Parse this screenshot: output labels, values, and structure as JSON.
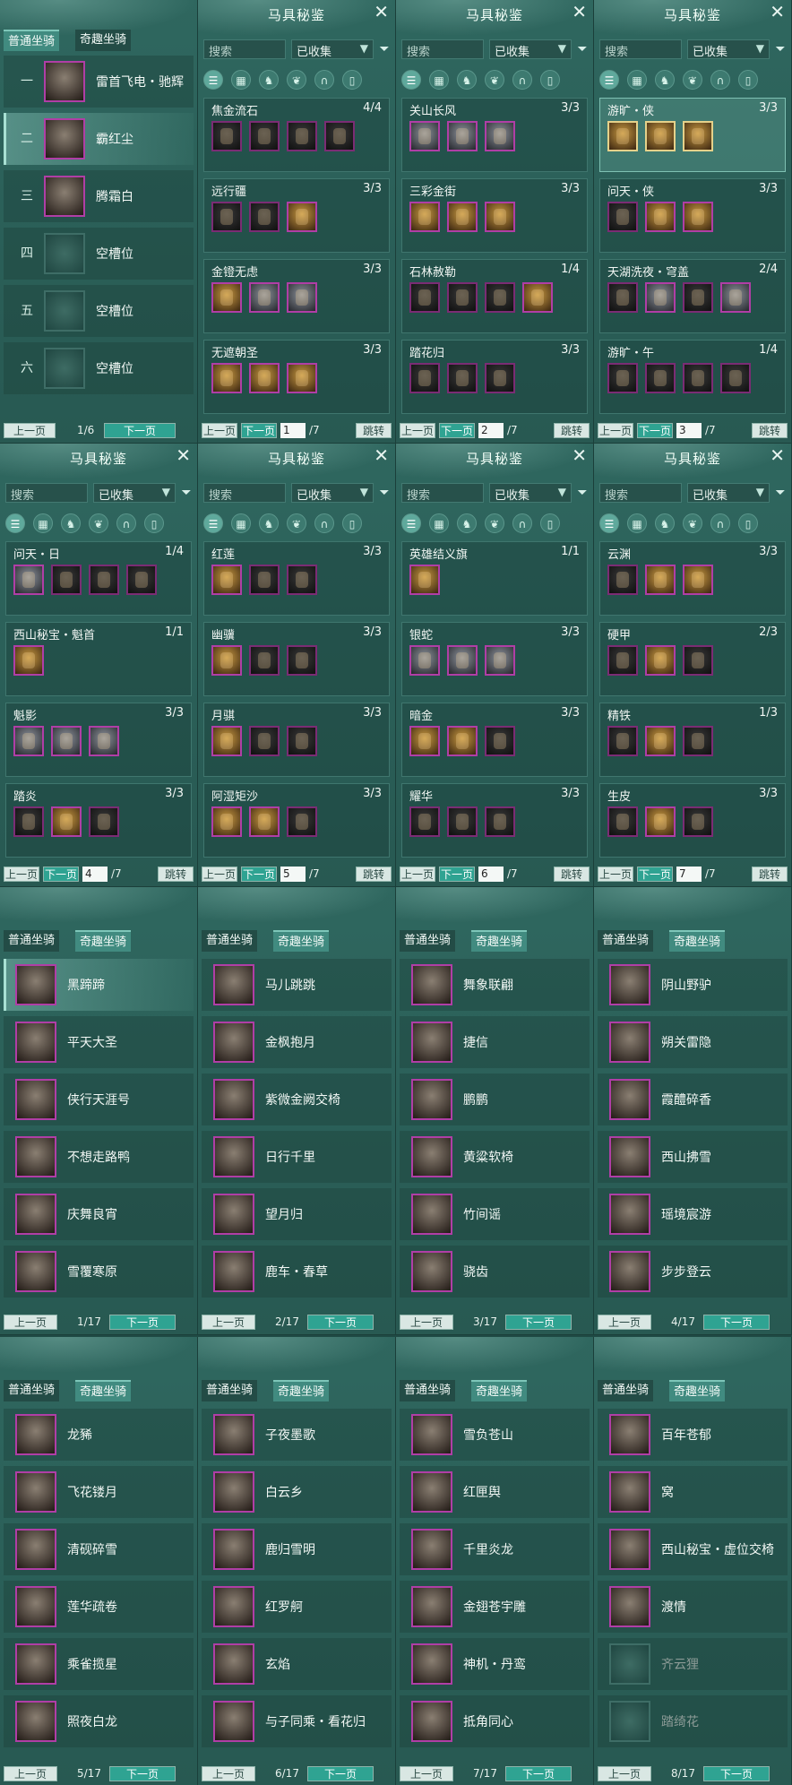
{
  "set_panels": [
    {
      "title": "马具秘鉴",
      "search": "搜索",
      "filter": "已收集",
      "page": "1",
      "total": "/7",
      "prev": "上一页",
      "next": "下一页",
      "jump": "跳转",
      "selected_icon": 0,
      "sets": [
        {
          "name": "焦金流石",
          "count": "4/4",
          "pieces": [
            "dark",
            "dark",
            "dark",
            "dark"
          ]
        },
        {
          "name": "远行疆",
          "count": "3/3",
          "pieces": [
            "dark",
            "dark",
            "gold"
          ]
        },
        {
          "name": "金镫无虑",
          "count": "3/3",
          "pieces": [
            "gold",
            "silver",
            "silver"
          ]
        },
        {
          "name": "无遮朝圣",
          "count": "3/3",
          "pieces": [
            "gold",
            "gold",
            "gold"
          ]
        }
      ]
    },
    {
      "title": "马具秘鉴",
      "search": "搜索",
      "filter": "已收集",
      "page": "2",
      "total": "/7",
      "prev": "上一页",
      "next": "下一页",
      "jump": "跳转",
      "selected_icon": 0,
      "sets": [
        {
          "name": "关山长风",
          "count": "3/3",
          "pieces": [
            "silver",
            "silver",
            "silver"
          ]
        },
        {
          "name": "三彩金街",
          "count": "3/3",
          "pieces": [
            "gold",
            "gold",
            "gold"
          ]
        },
        {
          "name": "石林赦勒",
          "count": "1/4",
          "pieces": [
            "dark",
            "dark",
            "dark",
            "gold"
          ]
        },
        {
          "name": "踏花归",
          "count": "3/3",
          "pieces": [
            "dark",
            "dark",
            "dark"
          ]
        }
      ]
    },
    {
      "title": "马具秘鉴",
      "search": "搜索",
      "filter": "已收集",
      "page": "3",
      "total": "/7",
      "prev": "上一页",
      "next": "下一页",
      "jump": "跳转",
      "selected_icon": 0,
      "sets": [
        {
          "name": "游旷・侠",
          "count": "3/3",
          "pieces": [
            "gold",
            "gold",
            "gold"
          ],
          "selected": true
        },
        {
          "name": "问天・侠",
          "count": "3/3",
          "pieces": [
            "dark",
            "gold",
            "gold"
          ]
        },
        {
          "name": "天湖洗夜・穹盖",
          "count": "2/4",
          "pieces": [
            "dark",
            "silver",
            "dark",
            "silver"
          ]
        },
        {
          "name": "游旷・午",
          "count": "1/4",
          "pieces": [
            "dark",
            "dark",
            "dark",
            "dark"
          ]
        }
      ]
    },
    {
      "title": "马具秘鉴",
      "search": "搜索",
      "filter": "已收集",
      "page": "4",
      "total": "/7",
      "prev": "上一页",
      "next": "下一页",
      "jump": "跳转",
      "selected_icon": 0,
      "sets": [
        {
          "name": "问天・日",
          "count": "1/4",
          "pieces": [
            "silver",
            "dark",
            "dark",
            "dark"
          ]
        },
        {
          "name": "西山秘宝・魁首",
          "count": "1/1",
          "pieces": [
            "gold"
          ]
        },
        {
          "name": "魁影",
          "count": "3/3",
          "pieces": [
            "silver",
            "silver",
            "silver"
          ]
        },
        {
          "name": "踏炎",
          "count": "3/3",
          "pieces": [
            "dark",
            "gold",
            "dark"
          ]
        }
      ]
    },
    {
      "title": "马具秘鉴",
      "search": "搜索",
      "filter": "已收集",
      "page": "5",
      "total": "/7",
      "prev": "上一页",
      "next": "下一页",
      "jump": "跳转",
      "selected_icon": 0,
      "sets": [
        {
          "name": "红莲",
          "count": "3/3",
          "pieces": [
            "gold",
            "dark",
            "dark"
          ]
        },
        {
          "name": "幽骥",
          "count": "3/3",
          "pieces": [
            "gold",
            "dark",
            "dark"
          ]
        },
        {
          "name": "月骐",
          "count": "3/3",
          "pieces": [
            "gold",
            "dark",
            "dark"
          ]
        },
        {
          "name": "阿湿矩沙",
          "count": "3/3",
          "pieces": [
            "gold",
            "gold",
            "dark"
          ]
        }
      ]
    },
    {
      "title": "马具秘鉴",
      "search": "搜索",
      "filter": "已收集",
      "page": "6",
      "total": "/7",
      "prev": "上一页",
      "next": "下一页",
      "jump": "跳转",
      "selected_icon": 0,
      "sets": [
        {
          "name": "英雄结义旗",
          "count": "1/1",
          "pieces": [
            "gold"
          ]
        },
        {
          "name": "银蛇",
          "count": "3/3",
          "pieces": [
            "silver",
            "silver",
            "silver"
          ]
        },
        {
          "name": "暗金",
          "count": "3/3",
          "pieces": [
            "gold",
            "gold",
            "dark"
          ]
        },
        {
          "name": "耀华",
          "count": "3/3",
          "pieces": [
            "dark",
            "dark",
            "dark"
          ]
        }
      ]
    },
    {
      "title": "马具秘鉴",
      "search": "搜索",
      "filter": "已收集",
      "page": "7",
      "total": "/7",
      "prev": "上一页",
      "next": "下一页",
      "jump": "跳转",
      "selected_icon": 0,
      "sets": [
        {
          "name": "云渊",
          "count": "3/3",
          "pieces": [
            "dark",
            "gold",
            "gold"
          ]
        },
        {
          "name": "硬甲",
          "count": "2/3",
          "pieces": [
            "dark",
            "gold",
            "dark"
          ]
        },
        {
          "name": "精铁",
          "count": "1/3",
          "pieces": [
            "dark",
            "gold",
            "dark"
          ]
        },
        {
          "name": "生皮",
          "count": "3/3",
          "pieces": [
            "dark",
            "gold",
            "dark"
          ]
        }
      ]
    }
  ],
  "normal_panel": {
    "tab_normal": "普通坐骑",
    "tab_fun": "奇趣坐骑",
    "page": "1/6",
    "prev": "上一页",
    "next": "下一页",
    "rows": [
      {
        "num": "一",
        "name": "雷首飞电・驰辉"
      },
      {
        "num": "二",
        "name": "霸红尘",
        "selected": true
      },
      {
        "num": "三",
        "name": "腾霜白"
      },
      {
        "num": "四",
        "name": "空槽位",
        "empty": true
      },
      {
        "num": "五",
        "name": "空槽位",
        "empty": true
      },
      {
        "num": "六",
        "name": "空槽位",
        "empty": true
      }
    ]
  },
  "fun_panels": [
    {
      "tab_normal": "普通坐骑",
      "tab_fun": "奇趣坐骑",
      "page": "1/17",
      "prev": "上一页",
      "next": "下一页",
      "rows": [
        {
          "name": "黑蹄蹄",
          "selected": true
        },
        {
          "name": "平天大圣"
        },
        {
          "name": "侠行天涯号"
        },
        {
          "name": "不想走路鸭"
        },
        {
          "name": "庆舞良宵"
        },
        {
          "name": "雪覆寒原"
        }
      ]
    },
    {
      "tab_normal": "普通坐骑",
      "tab_fun": "奇趣坐骑",
      "page": "2/17",
      "prev": "上一页",
      "next": "下一页",
      "rows": [
        {
          "name": "马儿跳跳"
        },
        {
          "name": "金枫抱月"
        },
        {
          "name": "紫微金阙交椅"
        },
        {
          "name": "日行千里"
        },
        {
          "name": "望月归"
        },
        {
          "name": "鹿车・春草"
        }
      ]
    },
    {
      "tab_normal": "普通坐骑",
      "tab_fun": "奇趣坐骑",
      "page": "3/17",
      "prev": "上一页",
      "next": "下一页",
      "rows": [
        {
          "name": "舞象联翩"
        },
        {
          "name": "捷信"
        },
        {
          "name": "鹏鹏"
        },
        {
          "name": "黄粱软椅"
        },
        {
          "name": "竹间谣"
        },
        {
          "name": "骁齿"
        }
      ]
    },
    {
      "tab_normal": "普通坐骑",
      "tab_fun": "奇趣坐骑",
      "page": "4/17",
      "prev": "上一页",
      "next": "下一页",
      "rows": [
        {
          "name": "阴山野驴"
        },
        {
          "name": "朔关雷隐"
        },
        {
          "name": "霞醴碎香"
        },
        {
          "name": "西山拂雪"
        },
        {
          "name": "瑶境宸游"
        },
        {
          "name": "步步登云"
        }
      ]
    },
    {
      "tab_normal": "普通坐骑",
      "tab_fun": "奇趣坐骑",
      "page": "5/17",
      "prev": "上一页",
      "next": "下一页",
      "rows": [
        {
          "name": "龙豨"
        },
        {
          "name": "飞花镂月"
        },
        {
          "name": "清砚碎雪"
        },
        {
          "name": "莲华疏卷"
        },
        {
          "name": "乘雀揽星"
        },
        {
          "name": "照夜白龙"
        }
      ]
    },
    {
      "tab_normal": "普通坐骑",
      "tab_fun": "奇趣坐骑",
      "page": "6/17",
      "prev": "上一页",
      "next": "下一页",
      "rows": [
        {
          "name": "子夜墨歌"
        },
        {
          "name": "白云乡"
        },
        {
          "name": "鹿归雪明"
        },
        {
          "name": "红罗舸"
        },
        {
          "name": "玄焰"
        },
        {
          "name": "与子同乘・看花归"
        }
      ]
    },
    {
      "tab_normal": "普通坐骑",
      "tab_fun": "奇趣坐骑",
      "page": "7/17",
      "prev": "上一页",
      "next": "下一页",
      "rows": [
        {
          "name": "雪负苍山"
        },
        {
          "name": "红匣舆"
        },
        {
          "name": "千里炎龙"
        },
        {
          "name": "金翅苍宇雕"
        },
        {
          "name": "神机・丹鸾"
        },
        {
          "name": "抵角同心"
        }
      ]
    },
    {
      "tab_normal": "普通坐骑",
      "tab_fun": "奇趣坐骑",
      "page": "8/17",
      "prev": "上一页",
      "next": "下一页",
      "rows": [
        {
          "name": "百年苍郁"
        },
        {
          "name": "窝"
        },
        {
          "name": "西山秘宝・虚位交椅"
        },
        {
          "name": "渡情"
        },
        {
          "name": "齐云狸",
          "dim": true
        },
        {
          "name": "踏绮花",
          "dim": true
        }
      ]
    }
  ],
  "icon_names": [
    "list-icon",
    "grid-icon",
    "horse-head-icon",
    "saddle-icon",
    "stirrup-icon",
    "armor-icon"
  ]
}
